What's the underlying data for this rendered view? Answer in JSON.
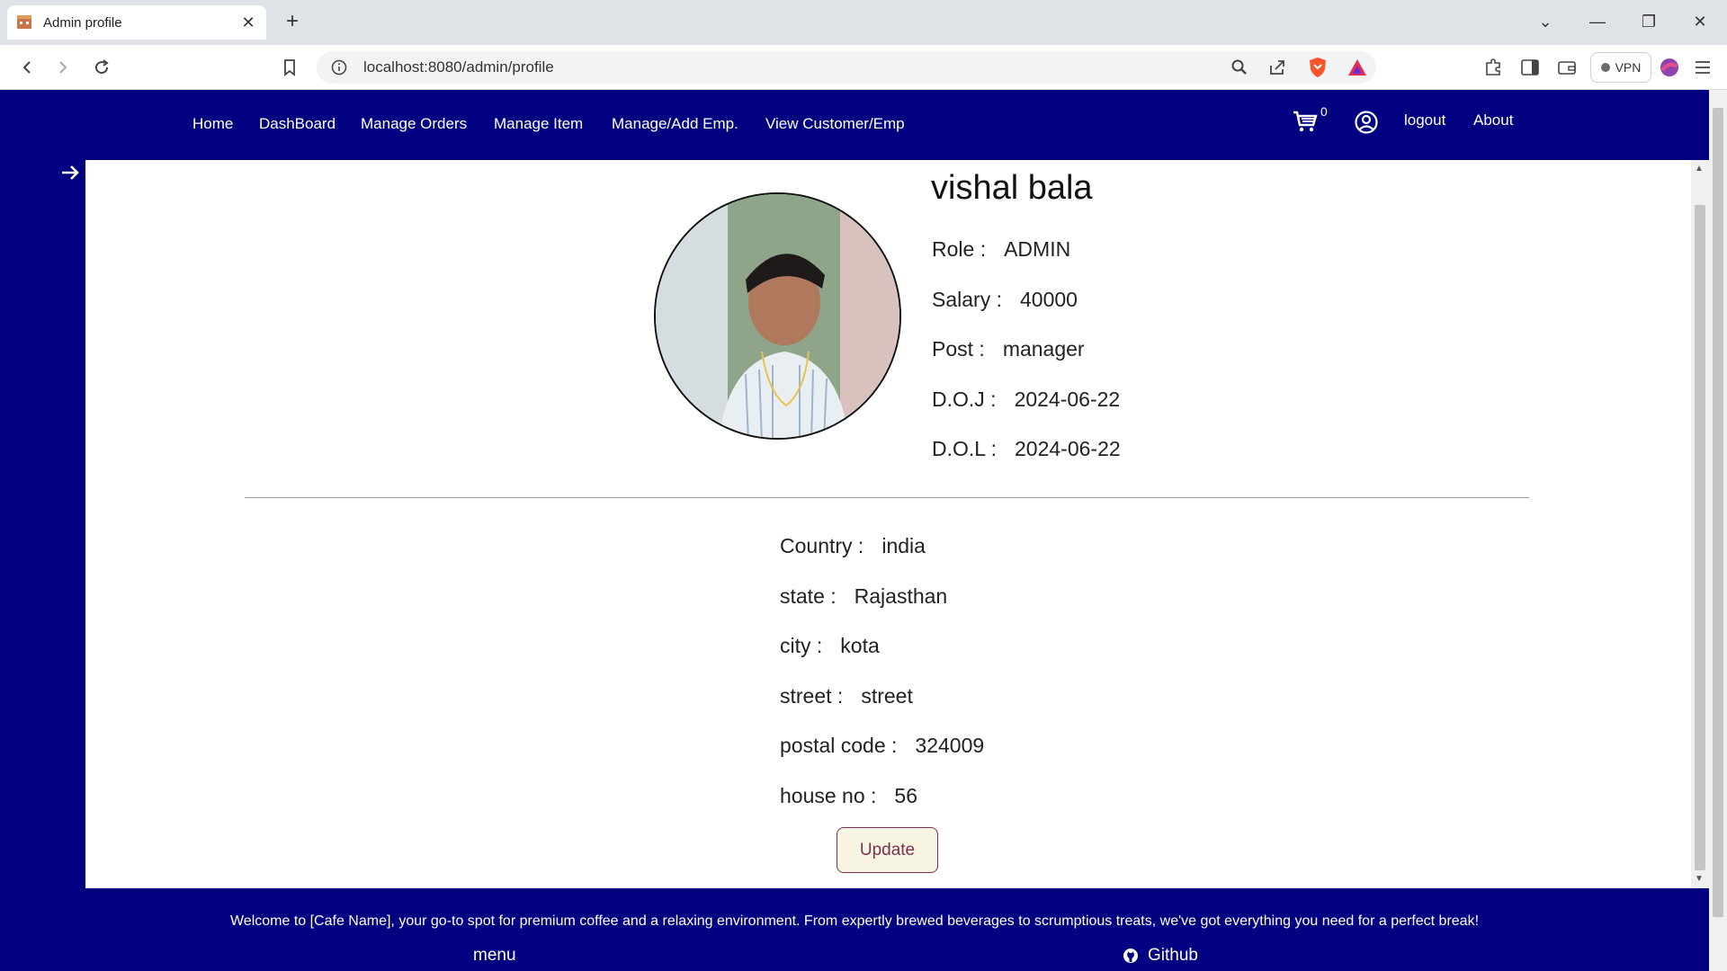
{
  "browser": {
    "tab_title": "Admin profile",
    "url": "localhost:8080/admin/profile",
    "vpn_label": "VPN"
  },
  "nav": {
    "links": [
      "Home",
      "DashBoard",
      "Manage Orders",
      "Manage Item",
      "Manage/Add Emp.",
      "View Customer/Emp"
    ],
    "cart_count": "0",
    "logout": "logout",
    "about": "About"
  },
  "profile": {
    "name": "vishal bala",
    "role_label": "Role :",
    "role": "ADMIN",
    "salary_label": "Salary :",
    "salary": "40000",
    "post_label": "Post :",
    "post": "manager",
    "doj_label": "D.O.J :",
    "doj": "2024-06-22",
    "dol_label": "D.O.L :",
    "dol": "2024-06-22"
  },
  "address": {
    "country_label": "Country :",
    "country": "india",
    "state_label": "state :",
    "state": "Rajasthan",
    "city_label": "city :",
    "city": "kota",
    "street_label": "street :",
    "street": "street",
    "postal_label": "postal code :",
    "postal": "324009",
    "house_label": "house no :",
    "house": "56"
  },
  "update_label": "Update",
  "footer": {
    "text": "Welcome to [Cafe Name], your go-to spot for premium coffee and a relaxing environment. From expertly brewed beverages to scrumptious treats, we've got everything you need for a perfect break!",
    "menu": "menu",
    "github": "Github"
  },
  "colors": {
    "nav_bg": "#000080",
    "update_bg": "#f7f4e2",
    "update_text": "#7a3050"
  },
  "icons": [
    "tab-favicon-icon",
    "close-tab-icon",
    "new-tab-icon",
    "back-icon",
    "forward-icon",
    "reload-icon",
    "bookmark-icon",
    "site-info-icon",
    "zoom-icon",
    "share-icon",
    "brave-shield-icon",
    "rewards-icon",
    "extensions-icon",
    "sidebar-icon",
    "wallet-icon",
    "profile-icon",
    "menu-icon",
    "cart-icon",
    "user-circle-icon",
    "arrow-right-icon",
    "github-icon"
  ]
}
